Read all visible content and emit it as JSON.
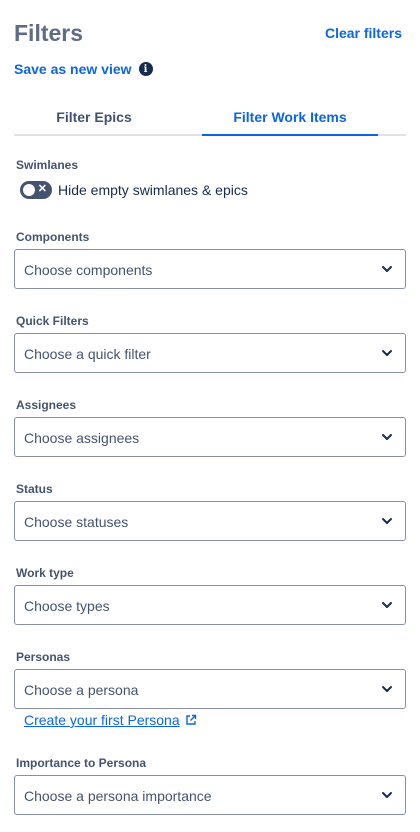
{
  "header": {
    "title": "Filters",
    "clear_label": "Clear filters"
  },
  "save_view": {
    "label": "Save as new view",
    "info_glyph": "i"
  },
  "tabs": [
    {
      "label": "Filter Epics",
      "active": false
    },
    {
      "label": "Filter Work Items",
      "active": true
    }
  ],
  "swimlanes": {
    "label": "Swimlanes",
    "toggle_label": "Hide empty swimlanes & epics",
    "toggle_state": "off",
    "toggle_glyph": "✕"
  },
  "filters": [
    {
      "label": "Components",
      "placeholder": "Choose components"
    },
    {
      "label": "Quick Filters",
      "placeholder": "Choose a quick filter"
    },
    {
      "label": "Assignees",
      "placeholder": "Choose assignees"
    },
    {
      "label": "Status",
      "placeholder": "Choose statuses"
    },
    {
      "label": "Work type",
      "placeholder": "Choose types"
    },
    {
      "label": "Personas",
      "placeholder": "Choose a persona"
    },
    {
      "label": "Importance to Persona",
      "placeholder": "Choose a persona importance"
    }
  ],
  "persona_link": {
    "label": "Create your first Persona"
  },
  "colors": {
    "accent": "#0c66e4",
    "title": "#5e6c84",
    "text": "#172b4d",
    "border": "#8590a2"
  },
  "icons": {
    "info": "info-icon",
    "chevron": "chevron-down-icon",
    "external": "external-link-icon",
    "toggle_off": "close-icon"
  }
}
